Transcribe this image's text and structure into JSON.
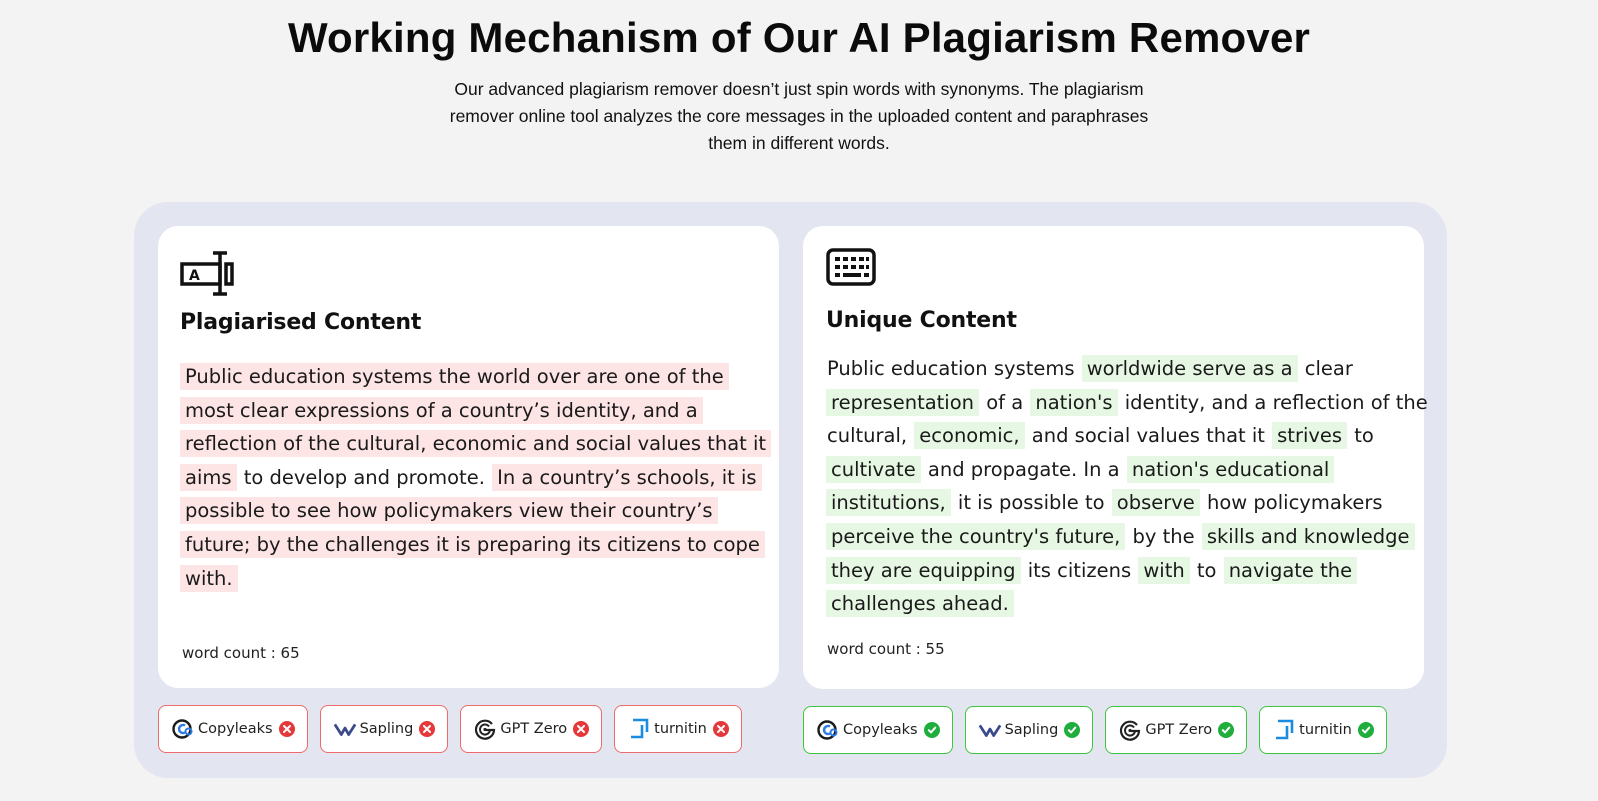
{
  "header": {
    "title": "Working Mechanism of Our AI Plagiarism Remover",
    "subtitle": "Our advanced plagiarism remover doesn’t just spin words with synonyms. The plagiarism remover online tool analyzes the core messages in the uploaded content and paraphrases them in different words."
  },
  "colors": {
    "page_bg": "#f3f3f3",
    "panel_bg": "#e3e5f1",
    "red_highlight": "#fde4e5",
    "green_highlight": "#e6f8e3",
    "fail_border": "#ef6a6a",
    "pass_border": "#3fc43f"
  },
  "left_card": {
    "icon": "text-cursor-icon",
    "title": "Plagiarised Content",
    "lines": [
      [
        {
          "t": "Public education systems the world over are one of the",
          "h": true
        }
      ],
      [
        {
          "t": "most clear expressions of a country’s identity, and a",
          "h": true
        }
      ],
      [
        {
          "t": "reflection of the cultural, economic and social values that it",
          "h": true
        }
      ],
      [
        {
          "t": "aims",
          "h": true
        },
        {
          "t": " to develop and promote. ",
          "h": false
        },
        {
          "t": "In a country’s schools, it is",
          "h": true
        }
      ],
      [
        {
          "t": "possible to see how policymakers view their country’s",
          "h": true
        }
      ],
      [
        {
          "t": "future; by the challenges it is preparing its citizens to cope",
          "h": true
        }
      ],
      [
        {
          "t": "with.",
          "h": true
        }
      ]
    ],
    "word_count": "word count : 65"
  },
  "right_card": {
    "icon": "keyboard-icon",
    "title": "Unique Content",
    "lines": [
      [
        {
          "t": "Public education systems ",
          "h": false
        },
        {
          "t": "worldwide serve as a",
          "h": true
        },
        {
          "t": " clear",
          "h": false
        }
      ],
      [
        {
          "t": "representation",
          "h": true
        },
        {
          "t": " of a ",
          "h": false
        },
        {
          "t": "nation's",
          "h": true
        },
        {
          "t": " identity, and a reflection of the",
          "h": false
        }
      ],
      [
        {
          "t": "cultural, ",
          "h": false
        },
        {
          "t": "economic,",
          "h": true
        },
        {
          "t": " and social values that it ",
          "h": false
        },
        {
          "t": "strives",
          "h": true
        },
        {
          "t": " to",
          "h": false
        }
      ],
      [
        {
          "t": "cultivate",
          "h": true
        },
        {
          "t": " and propagate. In a ",
          "h": false
        },
        {
          "t": "nation's educational",
          "h": true
        }
      ],
      [
        {
          "t": "institutions,",
          "h": true
        },
        {
          "t": " it is possible to ",
          "h": false
        },
        {
          "t": "observe",
          "h": true
        },
        {
          "t": " how policymakers",
          "h": false
        }
      ],
      [
        {
          "t": "perceive the country's future,",
          "h": true
        },
        {
          "t": " by the ",
          "h": false
        },
        {
          "t": "skills and knowledge",
          "h": true
        }
      ],
      [
        {
          "t": "they are equipping",
          "h": true
        },
        {
          "t": " its citizens ",
          "h": false
        },
        {
          "t": "with",
          "h": true
        },
        {
          "t": " to ",
          "h": false
        },
        {
          "t": "navigate the",
          "h": true
        }
      ],
      [
        {
          "t": "challenges ahead.",
          "h": true
        }
      ]
    ],
    "word_count": "word count : 55"
  },
  "detectors_left": [
    {
      "name": "Copyleaks",
      "icon": "copyleaks-logo-icon",
      "status": "fail",
      "status_icon": "x-icon"
    },
    {
      "name": "Sapling",
      "icon": "sapling-logo-icon",
      "status": "fail",
      "status_icon": "x-icon"
    },
    {
      "name": "GPT Zero",
      "icon": "gptzero-logo-icon",
      "status": "fail",
      "status_icon": "x-icon"
    },
    {
      "name": "turnitin",
      "icon": "turnitin-logo-icon",
      "status": "fail",
      "status_icon": "x-icon"
    }
  ],
  "detectors_right": [
    {
      "name": "Copyleaks",
      "icon": "copyleaks-logo-icon",
      "status": "pass",
      "status_icon": "check-icon"
    },
    {
      "name": "Sapling",
      "icon": "sapling-logo-icon",
      "status": "pass",
      "status_icon": "check-icon"
    },
    {
      "name": "GPT Zero",
      "icon": "gptzero-logo-icon",
      "status": "pass",
      "status_icon": "check-icon"
    },
    {
      "name": "turnitin",
      "icon": "turnitin-logo-icon",
      "status": "pass",
      "status_icon": "check-icon"
    }
  ]
}
